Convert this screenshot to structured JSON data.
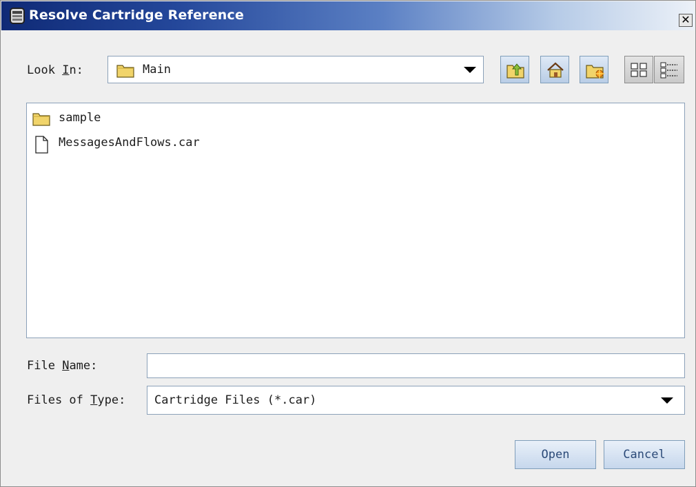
{
  "window": {
    "title": "Resolve Cartridge Reference",
    "close_glyph": "✕"
  },
  "look_in": {
    "label_before": "Look ",
    "label_mnemonic": "I",
    "label_after": "n:",
    "value": "Main",
    "value_icon": "folder-icon"
  },
  "toolbar": {
    "buttons": [
      {
        "name": "up-one-level-button",
        "icon": "folder-up-icon"
      },
      {
        "name": "home-button",
        "icon": "home-icon"
      },
      {
        "name": "new-folder-button",
        "icon": "new-folder-icon"
      },
      {
        "name": "list-view-button",
        "icon": "list-view-icon"
      },
      {
        "name": "details-view-button",
        "icon": "details-view-icon"
      }
    ]
  },
  "files": [
    {
      "name": "sample",
      "type": "folder",
      "icon": "folder-icon"
    },
    {
      "name": "MessagesAndFlows.car",
      "type": "file",
      "icon": "file-icon"
    }
  ],
  "file_name": {
    "label_before": "File ",
    "label_mnemonic": "N",
    "label_after": "ame:",
    "value": ""
  },
  "file_type": {
    "label_before": "Files of ",
    "label_mnemonic": "T",
    "label_after": "ype:",
    "value": "Cartridge Files (*.car)"
  },
  "buttons": {
    "open": "Open",
    "cancel": "Cancel"
  },
  "colors": {
    "title_bar_start": "#0f2a76",
    "title_bar_end": "#ecf1f8",
    "button_text": "#2b4a78"
  }
}
